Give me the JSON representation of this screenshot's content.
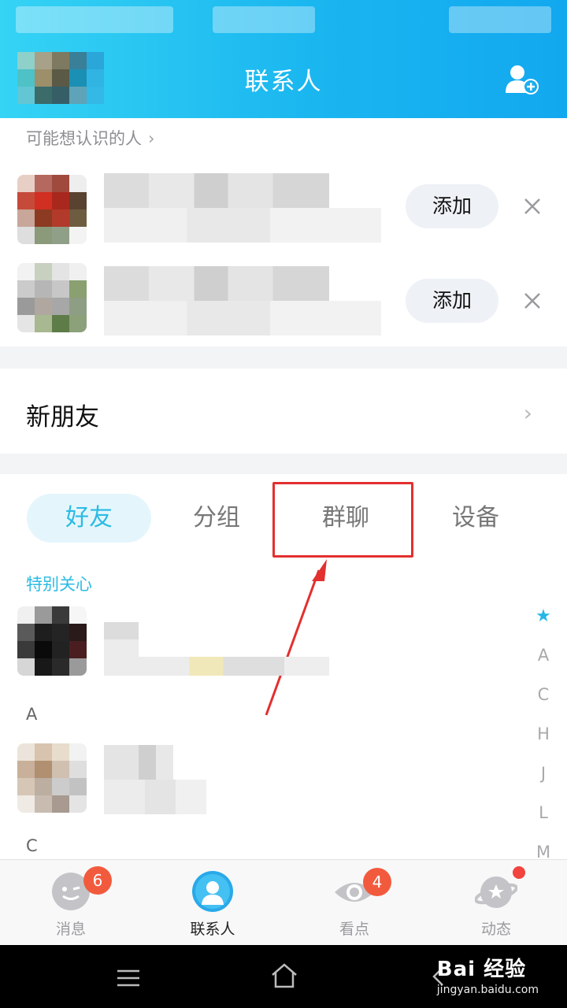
{
  "header": {
    "title": "联系人",
    "add_icon": "add-contact-icon"
  },
  "suggestions": {
    "title": "可能想认识的人",
    "chevron": "›",
    "items": [
      {
        "add_label": "添加"
      },
      {
        "add_label": "添加"
      }
    ]
  },
  "new_friends": {
    "label": "新朋友",
    "chevron": "›"
  },
  "tabs": [
    {
      "label": "好友",
      "active": true
    },
    {
      "label": "分组",
      "active": false
    },
    {
      "label": "群聊",
      "active": false
    },
    {
      "label": "设备",
      "active": false
    }
  ],
  "sections": {
    "special": "特别关心",
    "a": "A",
    "c": "C"
  },
  "index_bar": [
    "★",
    "A",
    "C",
    "H",
    "J",
    "L",
    "M"
  ],
  "bottom_nav": [
    {
      "label": "消息",
      "badge": "6",
      "icon": "message-icon"
    },
    {
      "label": "联系人",
      "badge": "",
      "icon": "contacts-icon",
      "active": true
    },
    {
      "label": "看点",
      "badge": "4",
      "icon": "watch-icon"
    },
    {
      "label": "动态",
      "badge": "",
      "icon": "planet-icon",
      "dot": true
    }
  ],
  "watermark": {
    "main": "Bai 经验",
    "url": "jingyan.baidu.com"
  },
  "colors": {
    "header_start": "#35d3f4",
    "header_end": "#12a8ef",
    "accent": "#2bbbe4",
    "annotation": "#e2302f",
    "badge": "#f25a3e"
  }
}
